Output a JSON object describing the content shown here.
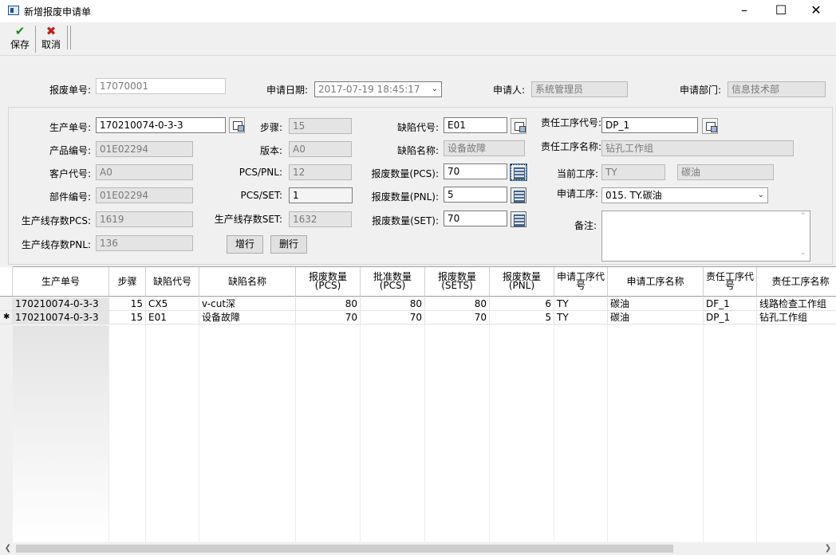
{
  "window": {
    "title": "新增报废申请单"
  },
  "toolbar": {
    "save_label": "保存",
    "cancel_label": "取消"
  },
  "header": {
    "scrap_no_label": "报废单号:",
    "scrap_no": "17070001",
    "apply_date_label": "申请日期:",
    "apply_date": "2017-07-19 18:45:17",
    "applicant_label": "申请人:",
    "applicant": "系统管理员",
    "dept_label": "申请部门:",
    "dept": "信息技术部"
  },
  "detail": {
    "prod_no_label": "生产单号:",
    "prod_no": "170210074-0-3-3",
    "product_code_label": "产品编号:",
    "product_code": "01E02294",
    "customer_code_label": "客户代号:",
    "customer_code": "A0",
    "part_no_label": "部件编号:",
    "part_no": "01E02294",
    "line_pcs_label": "生产线存数PCS:",
    "line_pcs": "1619",
    "line_pnl_label": "生产线存数PNL:",
    "line_pnl": "136",
    "step_label": "步骤:",
    "step": "15",
    "version_label": "版本:",
    "version": "A0",
    "pcs_pnl_label": "PCS/PNL:",
    "pcs_pnl": "12",
    "pcs_set_label": "PCS/SET:",
    "pcs_set": "1",
    "line_set_label": "生产线存数SET:",
    "line_set": "1632",
    "add_row_label": "增行",
    "del_row_label": "删行",
    "defect_code_label": "缺陷代号:",
    "defect_code": "E01",
    "defect_name_label": "缺陷名称:",
    "defect_name": "设备故障",
    "scrap_pcs_label": "报废数量(PCS):",
    "scrap_pcs": "70",
    "scrap_pnl_label": "报废数量(PNL):",
    "scrap_pnl": "5",
    "scrap_set_label": "报废数量(SET):",
    "scrap_set": "70",
    "resp_code_label": "责任工序代号:",
    "resp_code": "DP_1",
    "resp_name_label": "责任工序名称:",
    "resp_name": "钻孔工作组",
    "cur_proc_label": "当前工序:",
    "cur_proc_code": "TY",
    "cur_proc_name": "碳油",
    "apply_proc_label": "申请工序:",
    "apply_proc": "015. TY.碳油",
    "remark_label": "备注:",
    "remark": ""
  },
  "grid": {
    "columns": [
      "生产单号",
      "步骤",
      "缺陷代号",
      "缺陷名称",
      "报废数量(PCS)",
      "批准数量(PCS)",
      "报废数量(SETS)",
      "报废数量(PNL)",
      "申请工序代号",
      "申请工序名称",
      "责任工序代号",
      "责任工序名称"
    ],
    "rows": [
      {
        "marker": "",
        "cells": [
          "170210074-0-3-3",
          "15",
          "CX5",
          "v-cut深",
          "80",
          "80",
          "80",
          "6",
          "TY",
          "碳油",
          "DF_1",
          "线路检查工作组"
        ]
      },
      {
        "marker": "✱",
        "cells": [
          "170210074-0-3-3",
          "15",
          "E01",
          "设备故障",
          "70",
          "70",
          "70",
          "5",
          "TY",
          "碳油",
          "DP_1",
          "钻孔工作组"
        ]
      }
    ]
  }
}
